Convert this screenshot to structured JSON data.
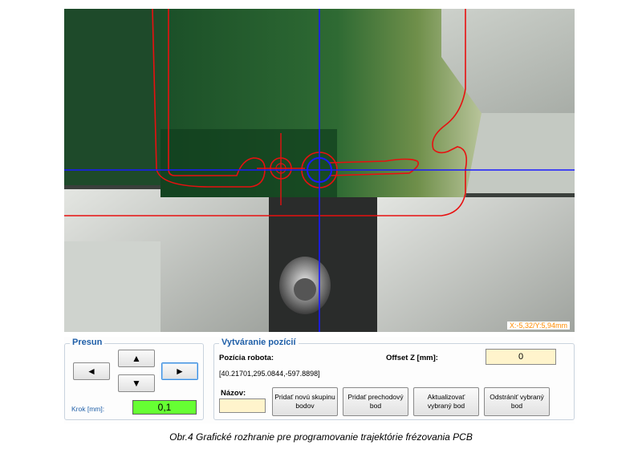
{
  "camera": {
    "coord_readout": "X:-5,32/Y:5,94mm"
  },
  "presun": {
    "title": "Presun",
    "up_icon": "▲",
    "down_icon": "▼",
    "left_icon": "◄",
    "right_icon": "►",
    "step_label": "Krok [mm]:",
    "step_value": "0,1"
  },
  "vytvaranie": {
    "title": "Vytváranie pozícií",
    "robot_position_label": "Pozícia robota:",
    "robot_position_value": "[40.21701,295.0844,-597.8898]",
    "offset_label": "Offset Z [mm]:",
    "offset_value": "0",
    "name_label": "Názov:",
    "name_value": "",
    "buttons": [
      "Pridať novú skupinu bodov",
      "Pridať prechodový bod",
      "Aktualizovať vybraný bod",
      "Odstrániť vybraný bod"
    ]
  },
  "caption": "Obr.4 Grafické rozhranie pre programovanie trajektórie frézovania PCB",
  "colors": {
    "crosshair": "#1a1aff",
    "outline": "#e81010",
    "step_field": "#66ff33",
    "input": "#fff4cc",
    "group_title": "#1f5fa8"
  }
}
